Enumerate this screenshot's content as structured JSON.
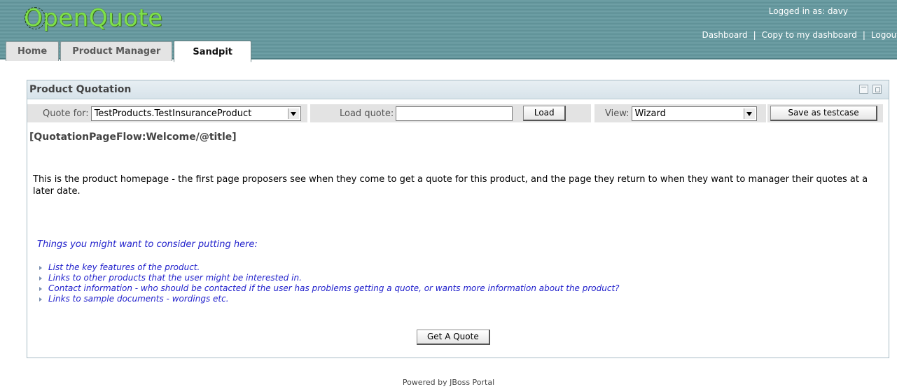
{
  "header": {
    "logo_first": "O",
    "logo_rest": "penQuote",
    "logged_in": "Logged in as: davy",
    "nav": [
      "Dashboard",
      "Copy to my dashboard",
      "Logout"
    ],
    "nav_separator": "|"
  },
  "tabs": [
    {
      "label": "Home",
      "active": false
    },
    {
      "label": "Product Manager",
      "active": false
    },
    {
      "label": "Sandpit",
      "active": true
    }
  ],
  "portlet": {
    "title": "Product Quotation",
    "icons": [
      "minimize-icon",
      "maximize-icon"
    ]
  },
  "toolbar": {
    "quote_for_label": "Quote for:",
    "quote_for_value": "TestProducts.TestInsuranceProduct",
    "load_quote_label": "Load quote:",
    "load_quote_value": "",
    "load_button": "Load",
    "view_label": "View:",
    "view_value": "Wizard",
    "save_button": "Save as testcase"
  },
  "content": {
    "page_heading": "[QuotationPageFlow:Welcome/@title]",
    "intro": "This is the product homepage - the first page proposers see when they come to get a quote for this product, and the page they return to when they want to manager their quotes at a later date.",
    "hint_heading": "Things you might want to consider putting here:",
    "hints": [
      "List the key features of the product.",
      "Links to other products that the user might be interested in.",
      "Contact information - who should be contacted if the user has problems getting a quote, or wants more information about the product?",
      "Links to sample documents - wordings etc."
    ],
    "get_quote_button": "Get A Quote"
  },
  "footer": "Powered by JBoss Portal",
  "colors": {
    "header_bg": "#6fa0a6",
    "logo": "#7ee04a",
    "hint_text": "#2222cc",
    "toolbar_bg": "#e3e3e3"
  }
}
